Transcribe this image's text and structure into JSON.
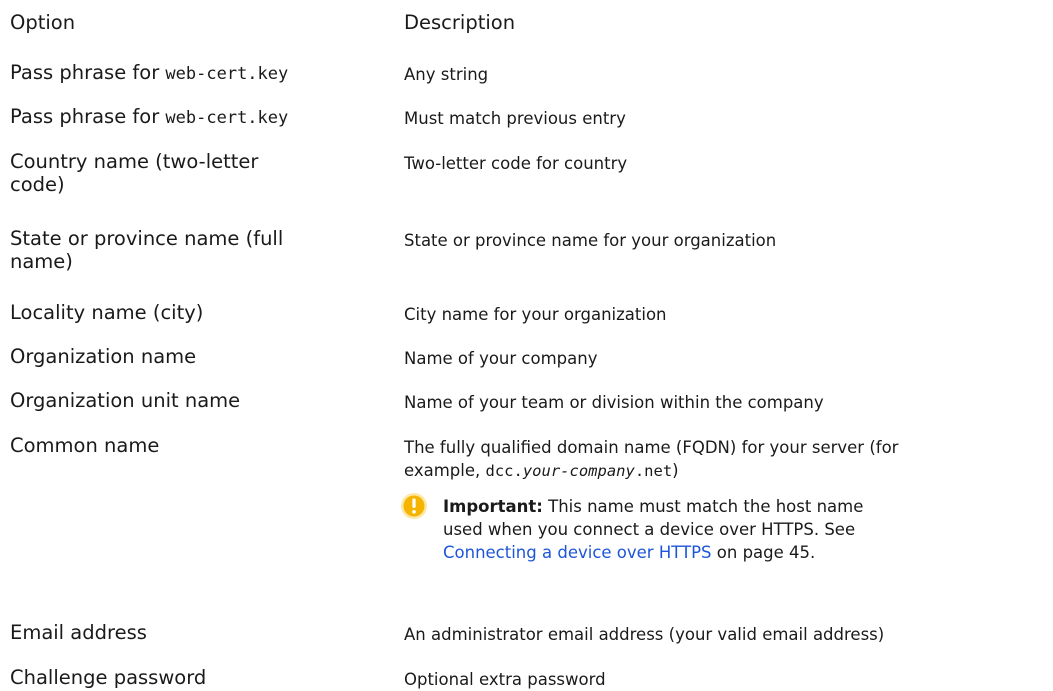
{
  "header": {
    "option": "Option",
    "description": "Description"
  },
  "rows": [
    {
      "option_prefix": "Pass phrase for ",
      "option_code": "web-cert.key",
      "description": "Any string"
    },
    {
      "option_prefix": "Pass phrase for ",
      "option_code": "web-cert.key",
      "description": "Must match previous entry"
    },
    {
      "option_line1": "Country name (two-letter",
      "option_line2": "code)",
      "description": "Two-letter code for country"
    },
    {
      "option_line1": "State or province name (full",
      "option_line2": "name)",
      "description": "State or province name for your organization"
    },
    {
      "option": "Locality name (city)",
      "description": "City name for your organization"
    },
    {
      "option": "Organization name",
      "description": "Name of your company"
    },
    {
      "option": "Organization unit name",
      "description": "Name of your team or division within the company"
    },
    {
      "option": "Common name",
      "description_line1": "The fully qualified domain name (FQDN) for your server (for",
      "description_prefix": "example, ",
      "code_a": "dcc.",
      "code_italic": "your-company",
      "code_b": ".net",
      "description_suffix": ")",
      "note": {
        "icon": "warning-icon",
        "label": "Important:",
        "text_line1": " This name must match the host name",
        "text_line2": "used when you connect a device over HTTPS. See",
        "link_text": "Connecting a device over HTTPS",
        "text_after_link": " on page 45."
      }
    },
    {
      "option": "Email address",
      "description": "An administrator email address (your valid email address)"
    },
    {
      "option": "Challenge password",
      "description": "Optional extra password"
    }
  ],
  "colors": {
    "link": "#1c55d8",
    "warning_icon_fill": "#f5b400",
    "warning_icon_rim": "#fde7a4"
  }
}
